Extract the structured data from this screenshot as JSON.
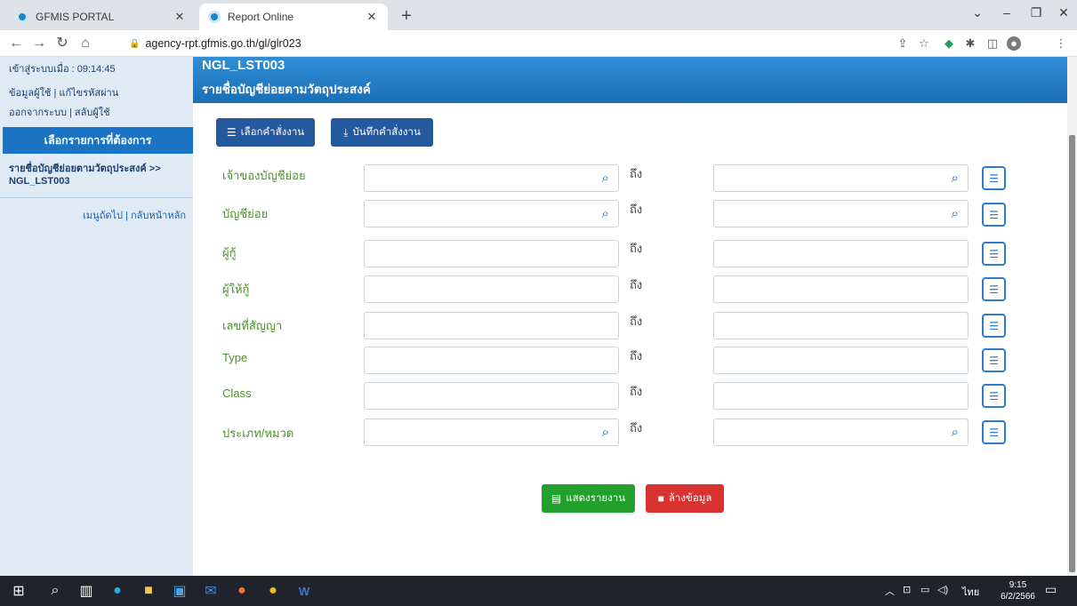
{
  "browser": {
    "tabs": [
      {
        "title": "GFMIS PORTAL",
        "active": false
      },
      {
        "title": "Report Online",
        "active": true
      }
    ],
    "url": "agency-rpt.gfmis.go.th/gl/glr023"
  },
  "sidebar": {
    "login_time": "เข้าสู่ระบบเมื่อ : 09:14:45",
    "user_info": "ข้อมูลผู้ใช้",
    "change_password": "แก้ไขรหัสผ่าน",
    "logout": "ออกจากระบบ",
    "switch_user": "สลับผู้ใช้",
    "header": "เลือกรายการที่ต้องการ",
    "current_item": "รายชื่อบัญชีย่อยตามวัตถุประสงค์ >>",
    "current_code": "NGL_LST003",
    "next_menu": "เมนูถัดไป",
    "home": "กลับหน้าหลัก",
    "separator": "|"
  },
  "banner": {
    "code": "NGL_LST003",
    "name": "รายชื่อบัญชีย่อยตามวัตถุประสงค์"
  },
  "actions": {
    "select_command": "เลือกคำสั่งงาน",
    "save_command": "บันทึกคำสั่งงาน",
    "show_report": "แสดงรายงาน",
    "clear_data": "ล้างข้อมูล"
  },
  "form": {
    "to_label": "ถึง",
    "rows": [
      {
        "label": "เจ้าของบัญชีย่อย",
        "search": true,
        "from": "",
        "to": ""
      },
      {
        "label": "บัญชีย่อย",
        "search": true,
        "from": "",
        "to": ""
      },
      {
        "label": "ผู้กู้",
        "search": false,
        "from": "",
        "to": ""
      },
      {
        "label": "ผู้ให้กู้",
        "search": false,
        "from": "",
        "to": ""
      },
      {
        "label": "เลขที่สัญญา",
        "search": false,
        "from": "",
        "to": ""
      },
      {
        "label": "Type",
        "search": false,
        "from": "",
        "to": ""
      },
      {
        "label": "Class",
        "search": false,
        "from": "",
        "to": ""
      },
      {
        "label": "ประเภท/หมวด",
        "search": true,
        "from": "",
        "to": ""
      }
    ]
  },
  "taskbar": {
    "language": "ไทย",
    "time": "9:15",
    "date": "6/2/2566"
  },
  "colors": {
    "banner": "#1a73c3",
    "sidebar": "#dfeaf5",
    "primary_button": "#25599e",
    "show_button": "#23a02c",
    "clear_button": "#d83330",
    "label_text": "#4c8f2e"
  }
}
